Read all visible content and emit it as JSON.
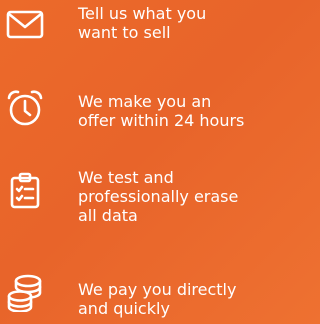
{
  "steps": [
    {
      "icon": "envelope-icon",
      "text": "Tell us what you\nwant to sell"
    },
    {
      "icon": "alarm-clock-icon",
      "text": "We make you an\noffer within 24 hours"
    },
    {
      "icon": "clipboard-checklist-icon",
      "text": "We test and\nprofessionally erase\nall data"
    },
    {
      "icon": "coins-stack-icon",
      "text": "We pay you directly\nand quickly"
    }
  ],
  "colors": {
    "background": "#e8642a",
    "foreground": "#ffffff"
  }
}
